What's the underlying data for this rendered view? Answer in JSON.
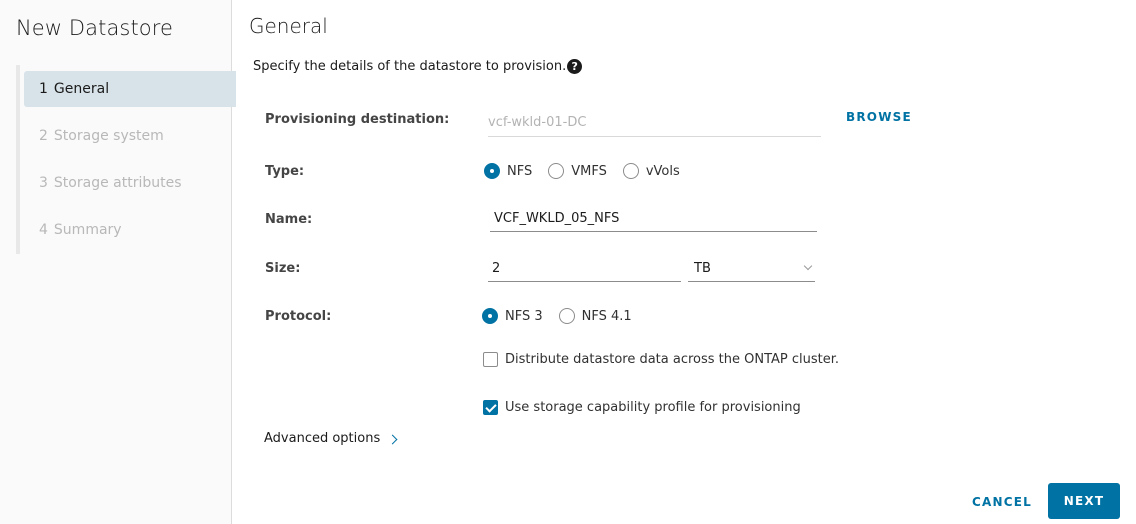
{
  "wizard": {
    "title": "New Datastore",
    "steps": [
      {
        "num": "1",
        "label": "General",
        "active": true
      },
      {
        "num": "2",
        "label": "Storage system",
        "active": false
      },
      {
        "num": "3",
        "label": "Storage attributes",
        "active": false
      },
      {
        "num": "4",
        "label": "Summary",
        "active": false
      }
    ]
  },
  "page": {
    "title": "General",
    "subtitle": "Specify the details of the datastore to provision.",
    "help_icon": "question-circle-icon"
  },
  "form": {
    "provisioning_destination": {
      "label": "Provisioning destination:",
      "value": "vcf-wkld-01-DC",
      "browse_label": "BROWSE"
    },
    "type": {
      "label": "Type:",
      "options": [
        "NFS",
        "VMFS",
        "vVols"
      ],
      "selected": "NFS"
    },
    "name": {
      "label": "Name:",
      "value": "VCF_WKLD_05_NFS"
    },
    "size": {
      "label": "Size:",
      "value": "2",
      "unit": "TB"
    },
    "protocol": {
      "label": "Protocol:",
      "options": [
        "NFS 3",
        "NFS 4.1"
      ],
      "selected": "NFS 3"
    },
    "distribute_checkbox": {
      "label": "Distribute datastore data across the ONTAP cluster.",
      "checked": false
    },
    "storage_profile_checkbox": {
      "label": "Use storage capability profile for provisioning",
      "checked": true
    },
    "advanced_options_label": "Advanced options"
  },
  "footer": {
    "cancel_label": "CANCEL",
    "next_label": "NEXT"
  },
  "colors": {
    "accent": "#0072a3",
    "active_step_bg": "#d8e3e9"
  }
}
